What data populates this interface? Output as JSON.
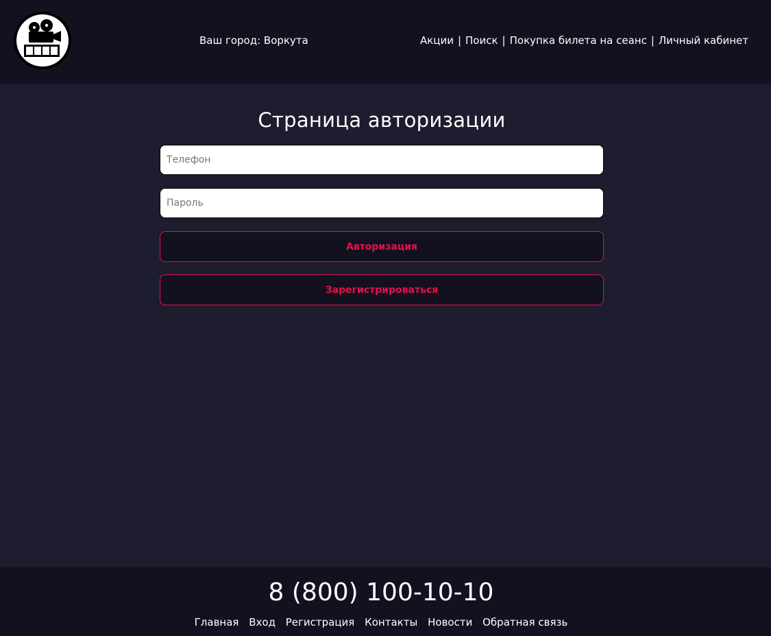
{
  "header": {
    "city_label": "Ваш город: Воркута",
    "nav": [
      {
        "label": "Акции"
      },
      {
        "label": "Поиск"
      },
      {
        "label": "Покупка билета на сеанс"
      },
      {
        "label": "Личный кабинет"
      }
    ],
    "nav_separator": "|",
    "logo_icon": "film-camera-icon"
  },
  "main": {
    "title": "Страница авторизации",
    "phone_placeholder": "Телефон",
    "password_placeholder": "Пароль",
    "login_button": "Авторизация",
    "register_button": "Зарегистрироваться"
  },
  "footer": {
    "phone": "8 (800) 100-10-10",
    "links": [
      {
        "label": "Главная"
      },
      {
        "label": "Вход"
      },
      {
        "label": "Регистрация"
      },
      {
        "label": "Контакты"
      },
      {
        "label": "Новости"
      },
      {
        "label": "Обратная связь"
      }
    ]
  },
  "colors": {
    "background": "#1e1c2f",
    "header_footer": "#13111f",
    "accent": "#e3124a",
    "text": "#ffffff"
  }
}
